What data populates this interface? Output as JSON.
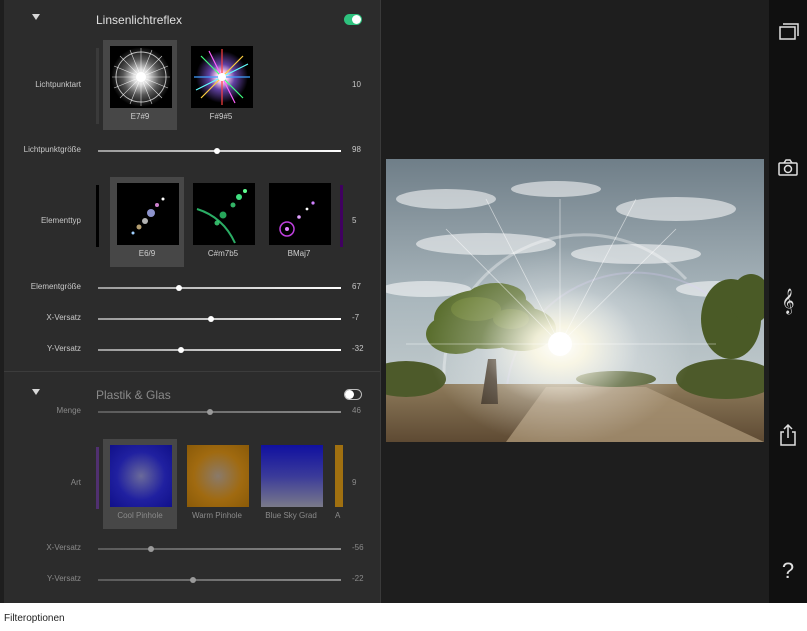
{
  "lens_flare": {
    "title": "Linsenlichtreflex",
    "enabled": true,
    "light_point_type": {
      "label": "Lichtpunktart",
      "value": "10",
      "tiles": [
        {
          "caption": "E7#9",
          "selected": true
        },
        {
          "caption": "F#9#5",
          "selected": false
        }
      ]
    },
    "light_point_size": {
      "label": "Lichtpunktgröße",
      "value": "98",
      "fraction": 0.49
    },
    "element_type": {
      "label": "Elementtyp",
      "value": "5",
      "tiles": [
        {
          "caption": "E6/9",
          "selected": true
        },
        {
          "caption": "C#m7b5",
          "selected": false
        },
        {
          "caption": "BMaj7",
          "selected": false
        }
      ]
    },
    "element_size": {
      "label": "Elementgröße",
      "value": "67",
      "fraction": 0.335
    },
    "x_offset": {
      "label": "X-Versatz",
      "value": "-7",
      "fraction": 0.465
    },
    "y_offset": {
      "label": "Y-Versatz",
      "value": "-32",
      "fraction": 0.34
    }
  },
  "plastic_glass": {
    "title": "Plastik & Glas",
    "enabled": false,
    "amount": {
      "label": "Menge",
      "value": "46",
      "fraction": 0.46
    },
    "type": {
      "label": "Art",
      "value": "9",
      "tiles": [
        {
          "caption": "Cool Pinhole",
          "selected": true
        },
        {
          "caption": "Warm Pinhole",
          "selected": false
        },
        {
          "caption": "Blue Sky Grad",
          "selected": false
        },
        {
          "caption": "A",
          "selected": false
        }
      ]
    },
    "x_offset": {
      "label": "X-Versatz",
      "value": "-56",
      "fraction": 0.22
    },
    "y_offset": {
      "label": "Y-Versatz",
      "value": "-22",
      "fraction": 0.39
    }
  },
  "toolbar": {
    "icons": [
      "windows-icon",
      "camera-icon",
      "treble-clef-icon",
      "share-icon",
      "help-icon"
    ],
    "help_glyph": "?",
    "clef_glyph": "𝄞"
  },
  "colors": {
    "toggle_on": "#2ec27e",
    "panel_bg": "#2c2c2c",
    "toolbar_bg": "#101010"
  },
  "caption": "Filteroptionen"
}
